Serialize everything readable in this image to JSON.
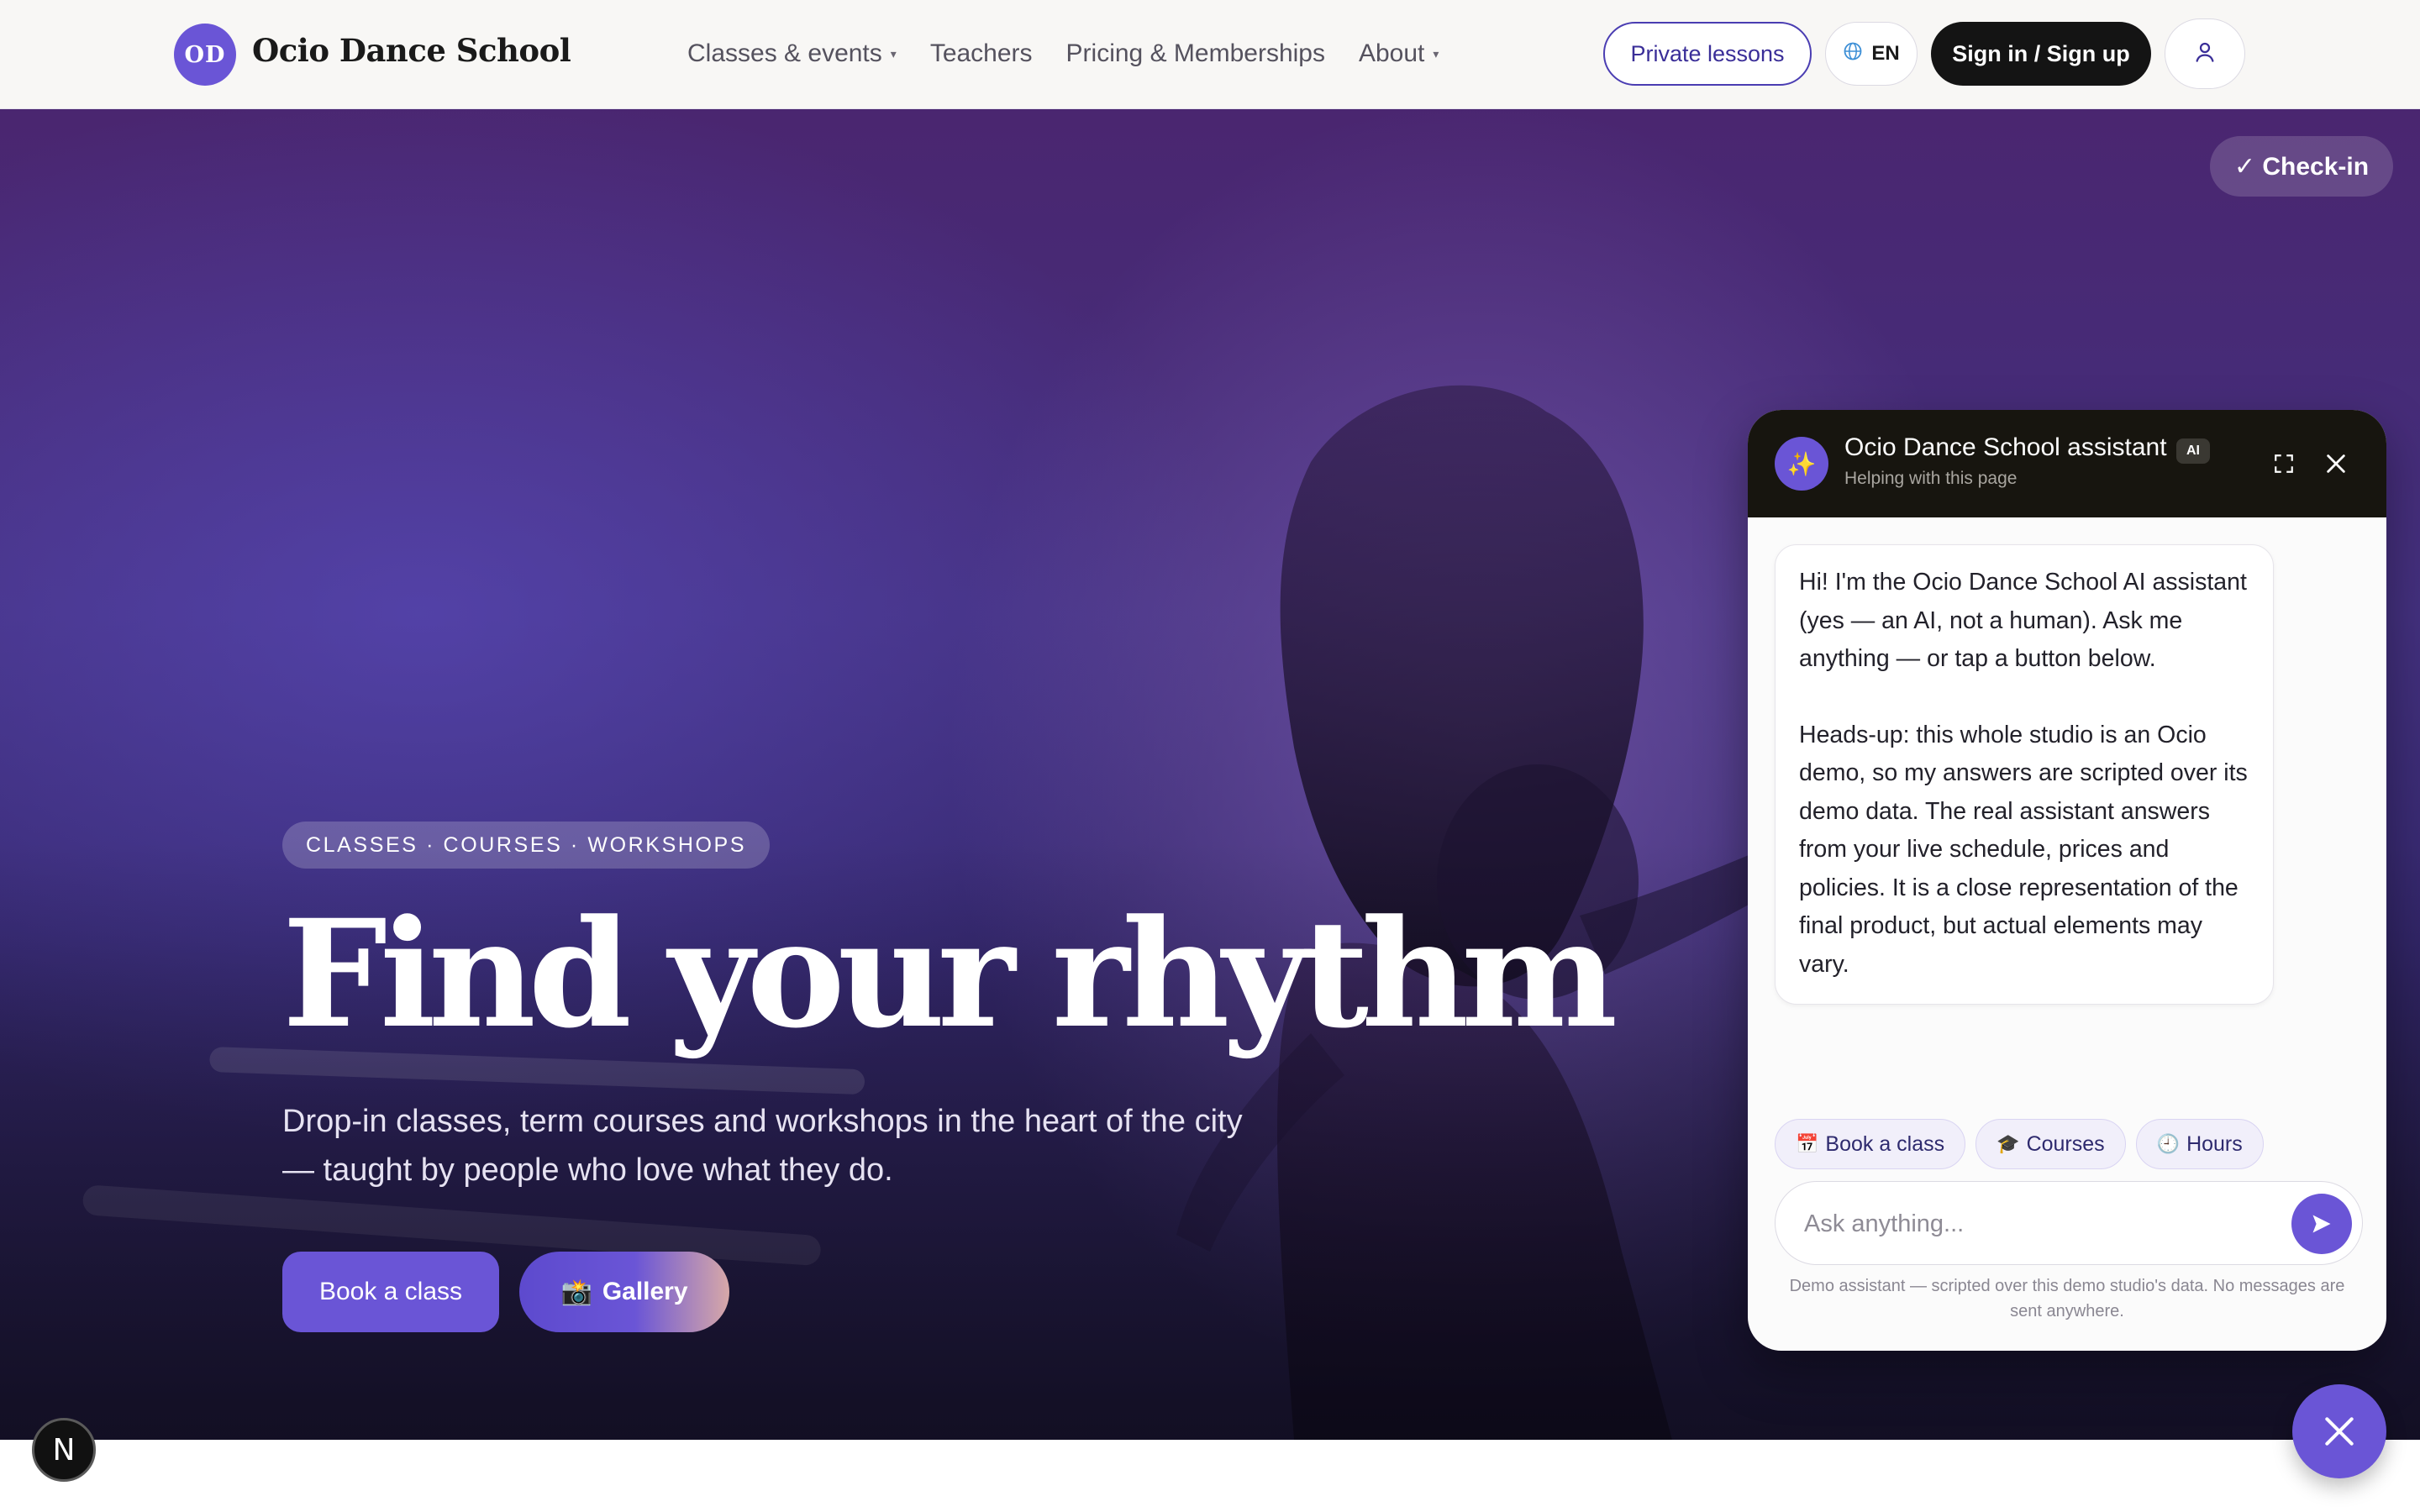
{
  "brand": {
    "initials": "OD",
    "name": "Ocio Dance School"
  },
  "nav": {
    "items": [
      {
        "label": "Classes & events",
        "dropdown": true
      },
      {
        "label": "Teachers",
        "dropdown": false
      },
      {
        "label": "Pricing & Memberships",
        "dropdown": false
      },
      {
        "label": "About",
        "dropdown": true
      }
    ],
    "caret": "▾"
  },
  "header_actions": {
    "private_lessons": "Private lessons",
    "language": "EN",
    "sign_in": "Sign in / Sign up"
  },
  "hero": {
    "checkin": "✓ Check-in",
    "tag": "CLASSES · COURSES · WORKSHOPS",
    "title": "Find your rhythm",
    "subtitle": "Drop-in classes, term courses and workshops in the heart of the city — taught by people who love what they do.",
    "book_button": "Book a class",
    "gallery_icon": "📸",
    "gallery_button": "Gallery"
  },
  "chat": {
    "avatar_icon": "✨",
    "title": "Ocio Dance School assistant",
    "ai_badge": "AI",
    "subtitle": "Helping with this page",
    "message_paragraphs": [
      "Hi! I'm the Ocio Dance School AI assistant (yes — an AI, not a human). Ask me anything — or tap a button below.",
      "Heads-up: this whole studio is an Ocio demo, so my answers are scripted over its demo data. The real assistant answers from your live schedule, prices and policies. It is a close representation of the final product, but actual elements may vary."
    ],
    "chips": [
      {
        "icon": "📅",
        "label": "Book a class"
      },
      {
        "icon": "🎓",
        "label": "Courses"
      },
      {
        "icon": "🕘",
        "label": "Hours"
      }
    ],
    "input_placeholder": "Ask anything...",
    "disclaimer": "Demo assistant — scripted over this demo studio's data. No messages are sent anywhere."
  },
  "floating": {
    "n_badge": "N"
  },
  "colors": {
    "accent": "#6a55d6",
    "dark": "#141414",
    "chat_header": "#17150f",
    "hero_top": "#4a2670",
    "hero_bottom": "#1d1834"
  }
}
